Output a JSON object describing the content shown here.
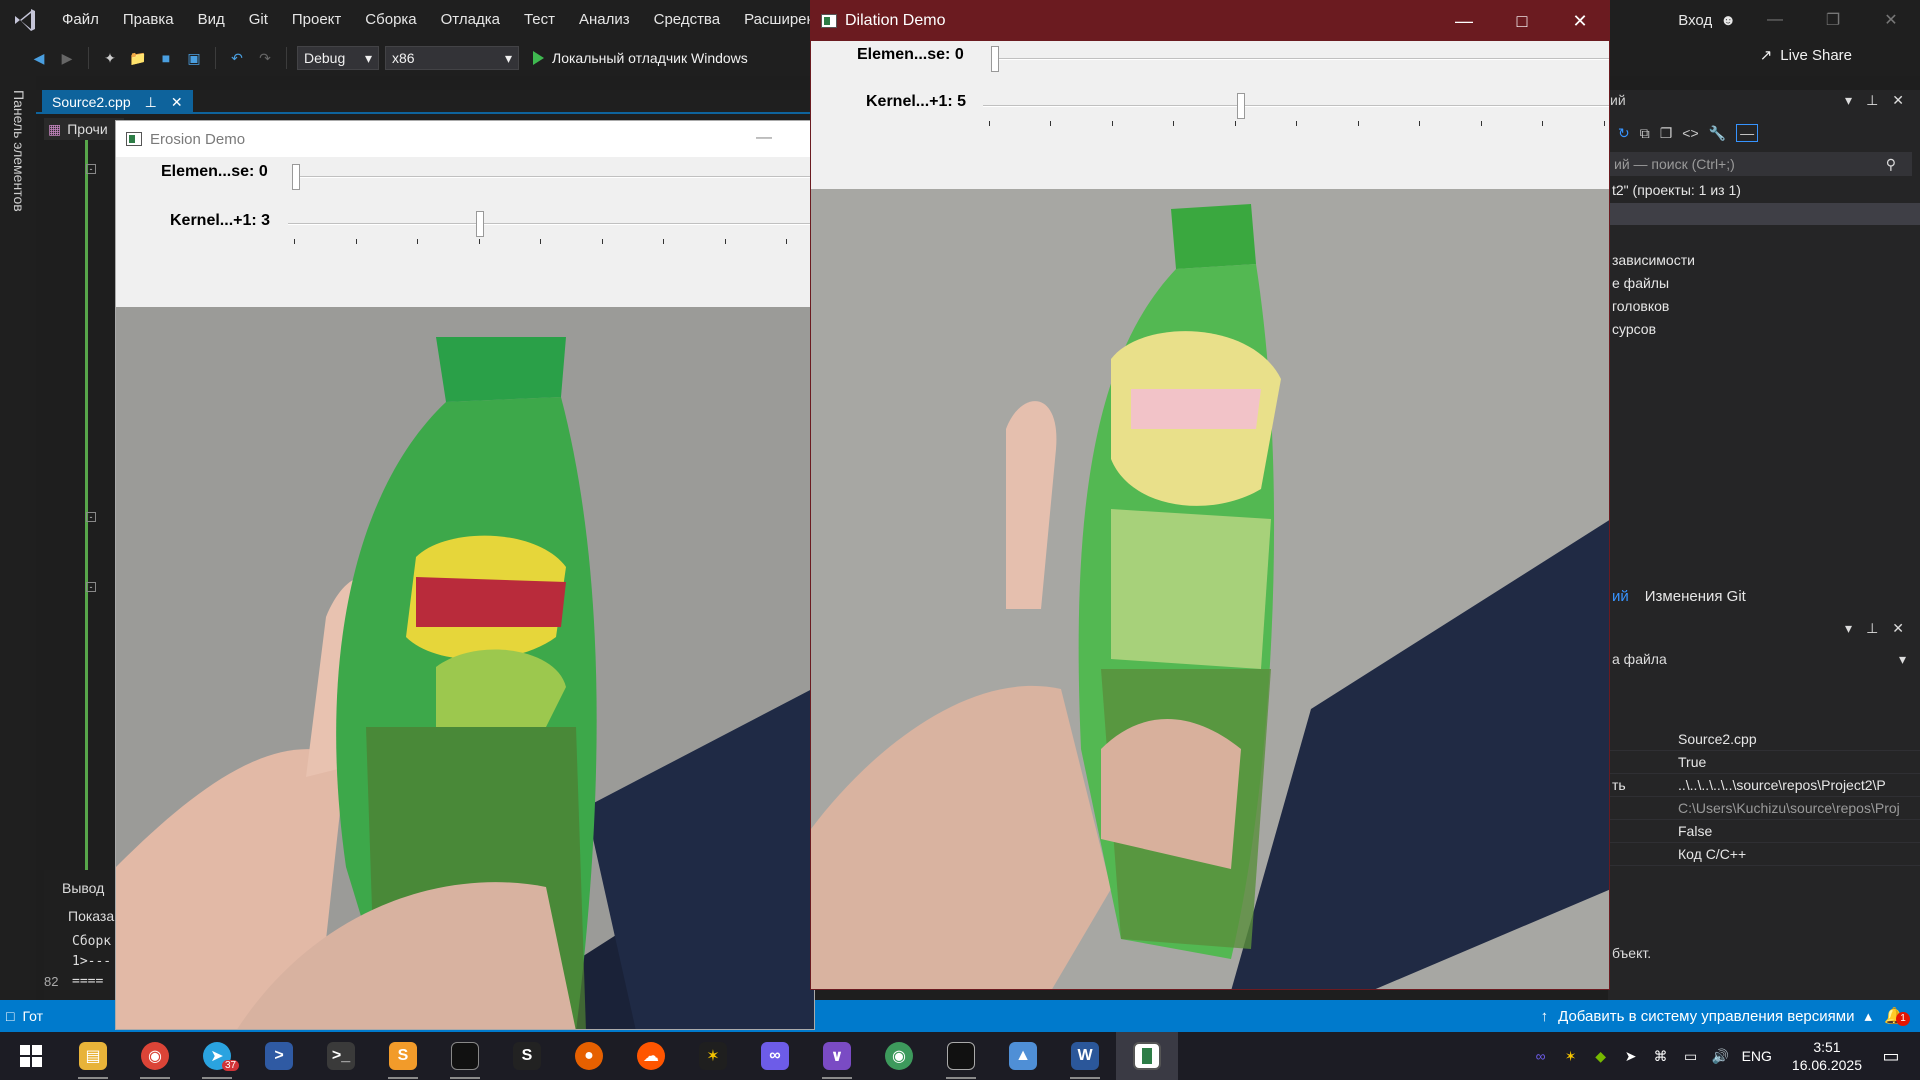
{
  "vs": {
    "menu": [
      "Файл",
      "Правка",
      "Вид",
      "Git",
      "Проект",
      "Сборка",
      "Отладка",
      "Тест",
      "Анализ",
      "Средства",
      "Расширени"
    ],
    "signin": "Вход",
    "toolbar": {
      "config": "Debug",
      "platform": "x86",
      "run_label": "Локальный отладчик Windows",
      "live_share": "Live Share"
    },
    "left_strip_label": "Панель элементов",
    "doc_tab": "Source2.cpp",
    "nav_label": "Прочи",
    "output": {
      "title": "Вывод",
      "show": "Показа",
      "lines": [
        "Сборк",
        "1>---",
        "===="
      ]
    },
    "line_number": "82",
    "status": {
      "ready": "Гот",
      "add_vc": "Добавить в систему управления версиями",
      "notif_count": "1"
    },
    "solution_explorer": {
      "header": "ий",
      "search_placeholder": "ий — поиск (Ctrl+;)",
      "solution": "t2\" (проекты: 1 из 1)",
      "items": [
        "зависимости",
        "е файлы",
        "головков",
        "сурсов"
      ]
    },
    "panel_tabs": [
      "ий",
      "Изменения Git"
    ],
    "properties": {
      "combo": "а файла",
      "rows": [
        {
          "key": "",
          "value": "Source2.cpp"
        },
        {
          "key": "",
          "value": "True"
        },
        {
          "key": "ть",
          "value": "..\\..\\..\\..\\..\\source\\repos\\Project2\\P"
        },
        {
          "key": "",
          "value": "C:\\Users\\Kuchizu\\source\\repos\\Proj"
        },
        {
          "key": "",
          "value": "False"
        },
        {
          "key": "",
          "value": "Код C/C++"
        }
      ],
      "description": "бъект."
    }
  },
  "erosion": {
    "title": "Erosion Demo",
    "trackbars": [
      {
        "label": "Elemen...se: 0",
        "value": 0,
        "max": 2
      },
      {
        "label": "Kernel...+1: 3",
        "value": 3,
        "max": 21
      }
    ]
  },
  "dilation": {
    "title": "Dilation Demo",
    "trackbars": [
      {
        "label": "Elemen...se: 0",
        "value": 0,
        "max": 2
      },
      {
        "label": "Kernel...+1: 5",
        "value": 5,
        "max": 20
      }
    ]
  },
  "taskbar": {
    "apps": [
      "start",
      "file-explorer",
      "chrome",
      "telegram",
      "powershell",
      "terminal",
      "sublime-text",
      "console",
      "scrivener",
      "firefox",
      "soundcloud",
      "spark",
      "link-app",
      "visual-studio",
      "chrome-canary",
      "cmd",
      "photos",
      "word",
      "demo-app"
    ],
    "telegram_badge": "37",
    "lang": "ENG",
    "time": "3:51",
    "date": "16.06.2025"
  },
  "colors": {
    "vs_accent": "#007acc",
    "dilation_titlebar": "#6b1b20",
    "status_bar": "#007acc"
  }
}
